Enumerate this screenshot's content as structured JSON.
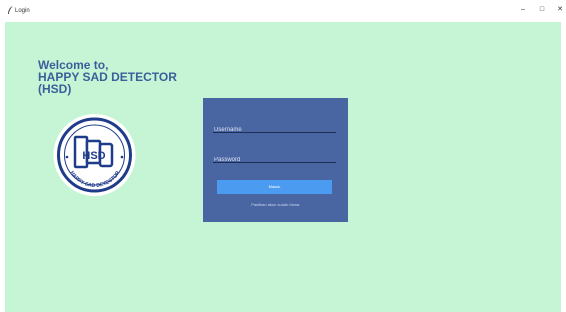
{
  "window": {
    "title": "Login",
    "minimize_glyph": "–",
    "maximize_glyph": "□",
    "close_glyph": "✕"
  },
  "welcome": {
    "line1": "Welcome to,",
    "line2": "HAPPY SAD DETECTOR",
    "line3": "(HSD)"
  },
  "logo": {
    "monogram": "HSD",
    "ring_text": "HAPPY SAD DETECTOR"
  },
  "login_form": {
    "username_placeholder": "Username",
    "password_placeholder": "Password",
    "login_button": "Masuk",
    "hint": "Pastikan akun sudah benar"
  },
  "colors": {
    "background": "#c6f5d6",
    "panel": "#4a66a2",
    "button": "#4b9cf0",
    "heading": "#3a5f9a"
  }
}
